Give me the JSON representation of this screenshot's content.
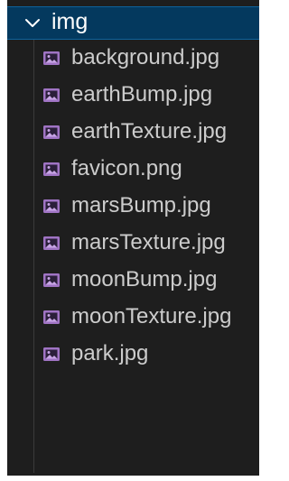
{
  "explorer": {
    "folder": {
      "label": "img",
      "expanded": true,
      "icon": "chevron-down-icon"
    },
    "files": [
      {
        "label": "background.jpg",
        "icon": "image-file-icon"
      },
      {
        "label": "earthBump.jpg",
        "icon": "image-file-icon"
      },
      {
        "label": "earthTexture.jpg",
        "icon": "image-file-icon"
      },
      {
        "label": "favicon.png",
        "icon": "image-file-icon"
      },
      {
        "label": "marsBump.jpg",
        "icon": "image-file-icon"
      },
      {
        "label": "marsTexture.jpg",
        "icon": "image-file-icon"
      },
      {
        "label": "moonBump.jpg",
        "icon": "image-file-icon"
      },
      {
        "label": "moonTexture.jpg",
        "icon": "image-file-icon"
      },
      {
        "label": "park.jpg",
        "icon": "image-file-icon"
      }
    ],
    "colors": {
      "background": "#1e1e1e",
      "selected_row": "#04395e",
      "selected_border": "#0e639c",
      "folder_text": "#ffffff",
      "file_text": "#cccccc",
      "image_icon": "#a074c4"
    }
  }
}
